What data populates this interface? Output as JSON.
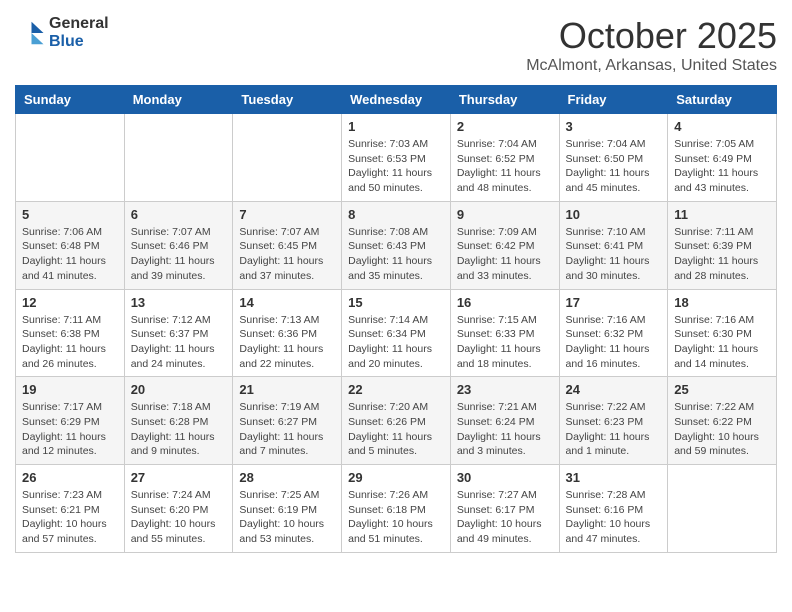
{
  "header": {
    "logo_general": "General",
    "logo_blue": "Blue",
    "month": "October 2025",
    "location": "McAlmont, Arkansas, United States"
  },
  "days_of_week": [
    "Sunday",
    "Monday",
    "Tuesday",
    "Wednesday",
    "Thursday",
    "Friday",
    "Saturday"
  ],
  "weeks": [
    [
      {
        "day": "",
        "info": ""
      },
      {
        "day": "",
        "info": ""
      },
      {
        "day": "",
        "info": ""
      },
      {
        "day": "1",
        "info": "Sunrise: 7:03 AM\nSunset: 6:53 PM\nDaylight: 11 hours and 50 minutes."
      },
      {
        "day": "2",
        "info": "Sunrise: 7:04 AM\nSunset: 6:52 PM\nDaylight: 11 hours and 48 minutes."
      },
      {
        "day": "3",
        "info": "Sunrise: 7:04 AM\nSunset: 6:50 PM\nDaylight: 11 hours and 45 minutes."
      },
      {
        "day": "4",
        "info": "Sunrise: 7:05 AM\nSunset: 6:49 PM\nDaylight: 11 hours and 43 minutes."
      }
    ],
    [
      {
        "day": "5",
        "info": "Sunrise: 7:06 AM\nSunset: 6:48 PM\nDaylight: 11 hours and 41 minutes."
      },
      {
        "day": "6",
        "info": "Sunrise: 7:07 AM\nSunset: 6:46 PM\nDaylight: 11 hours and 39 minutes."
      },
      {
        "day": "7",
        "info": "Sunrise: 7:07 AM\nSunset: 6:45 PM\nDaylight: 11 hours and 37 minutes."
      },
      {
        "day": "8",
        "info": "Sunrise: 7:08 AM\nSunset: 6:43 PM\nDaylight: 11 hours and 35 minutes."
      },
      {
        "day": "9",
        "info": "Sunrise: 7:09 AM\nSunset: 6:42 PM\nDaylight: 11 hours and 33 minutes."
      },
      {
        "day": "10",
        "info": "Sunrise: 7:10 AM\nSunset: 6:41 PM\nDaylight: 11 hours and 30 minutes."
      },
      {
        "day": "11",
        "info": "Sunrise: 7:11 AM\nSunset: 6:39 PM\nDaylight: 11 hours and 28 minutes."
      }
    ],
    [
      {
        "day": "12",
        "info": "Sunrise: 7:11 AM\nSunset: 6:38 PM\nDaylight: 11 hours and 26 minutes."
      },
      {
        "day": "13",
        "info": "Sunrise: 7:12 AM\nSunset: 6:37 PM\nDaylight: 11 hours and 24 minutes."
      },
      {
        "day": "14",
        "info": "Sunrise: 7:13 AM\nSunset: 6:36 PM\nDaylight: 11 hours and 22 minutes."
      },
      {
        "day": "15",
        "info": "Sunrise: 7:14 AM\nSunset: 6:34 PM\nDaylight: 11 hours and 20 minutes."
      },
      {
        "day": "16",
        "info": "Sunrise: 7:15 AM\nSunset: 6:33 PM\nDaylight: 11 hours and 18 minutes."
      },
      {
        "day": "17",
        "info": "Sunrise: 7:16 AM\nSunset: 6:32 PM\nDaylight: 11 hours and 16 minutes."
      },
      {
        "day": "18",
        "info": "Sunrise: 7:16 AM\nSunset: 6:30 PM\nDaylight: 11 hours and 14 minutes."
      }
    ],
    [
      {
        "day": "19",
        "info": "Sunrise: 7:17 AM\nSunset: 6:29 PM\nDaylight: 11 hours and 12 minutes."
      },
      {
        "day": "20",
        "info": "Sunrise: 7:18 AM\nSunset: 6:28 PM\nDaylight: 11 hours and 9 minutes."
      },
      {
        "day": "21",
        "info": "Sunrise: 7:19 AM\nSunset: 6:27 PM\nDaylight: 11 hours and 7 minutes."
      },
      {
        "day": "22",
        "info": "Sunrise: 7:20 AM\nSunset: 6:26 PM\nDaylight: 11 hours and 5 minutes."
      },
      {
        "day": "23",
        "info": "Sunrise: 7:21 AM\nSunset: 6:24 PM\nDaylight: 11 hours and 3 minutes."
      },
      {
        "day": "24",
        "info": "Sunrise: 7:22 AM\nSunset: 6:23 PM\nDaylight: 11 hours and 1 minute."
      },
      {
        "day": "25",
        "info": "Sunrise: 7:22 AM\nSunset: 6:22 PM\nDaylight: 10 hours and 59 minutes."
      }
    ],
    [
      {
        "day": "26",
        "info": "Sunrise: 7:23 AM\nSunset: 6:21 PM\nDaylight: 10 hours and 57 minutes."
      },
      {
        "day": "27",
        "info": "Sunrise: 7:24 AM\nSunset: 6:20 PM\nDaylight: 10 hours and 55 minutes."
      },
      {
        "day": "28",
        "info": "Sunrise: 7:25 AM\nSunset: 6:19 PM\nDaylight: 10 hours and 53 minutes."
      },
      {
        "day": "29",
        "info": "Sunrise: 7:26 AM\nSunset: 6:18 PM\nDaylight: 10 hours and 51 minutes."
      },
      {
        "day": "30",
        "info": "Sunrise: 7:27 AM\nSunset: 6:17 PM\nDaylight: 10 hours and 49 minutes."
      },
      {
        "day": "31",
        "info": "Sunrise: 7:28 AM\nSunset: 6:16 PM\nDaylight: 10 hours and 47 minutes."
      },
      {
        "day": "",
        "info": ""
      }
    ]
  ]
}
